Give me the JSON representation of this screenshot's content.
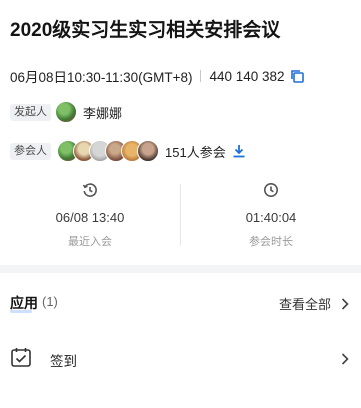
{
  "meeting": {
    "title": "2020级实习生实习相关安排会议",
    "datetime": "06月08日10:30-11:30(GMT+8)",
    "meeting_id": "440 140 382"
  },
  "host": {
    "tag": "发起人",
    "name": "李娜娜"
  },
  "attendees": {
    "tag": "参会人",
    "count_label": "151人参会"
  },
  "stats": {
    "last_join": {
      "value": "06/08 13:40",
      "label": "最近入会"
    },
    "duration": {
      "value": "01:40:04",
      "label": "参会时长"
    }
  },
  "apps": {
    "title": "应用",
    "count": "(1)",
    "view_all": "查看全部",
    "items": [
      {
        "label": "签到",
        "icon": "calendar-check-icon"
      }
    ]
  },
  "colors": {
    "accent": "#1e6fd9",
    "icon_gray": "#555555"
  }
}
